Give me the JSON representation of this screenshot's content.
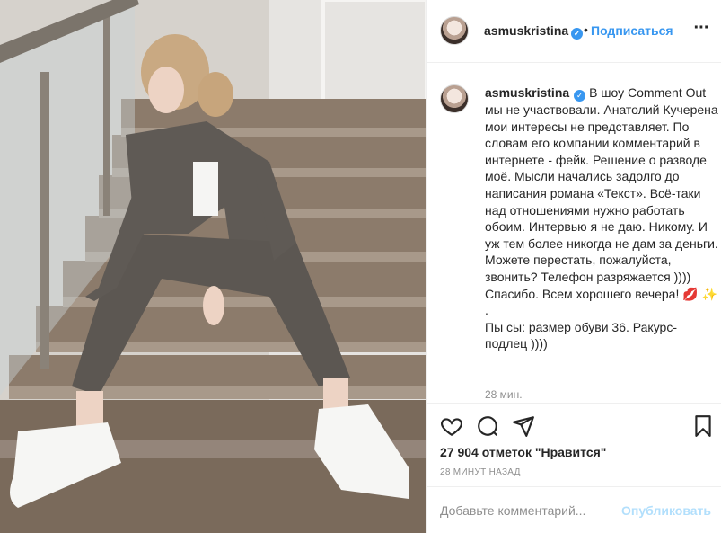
{
  "post": {
    "username": "asmuskristina",
    "verified_badge": "verified-icon",
    "follow_label": "Подписаться",
    "more_icon": "more-options-icon",
    "separator": "•"
  },
  "caption": {
    "username": "asmuskristina",
    "text": "В шоу Comment Out мы не участвовали. Анатолий Кучерена мои интересы не представляет. По словам его компании комментарий в интернете - фейк. Решение о разводе моё. Мысли начались задолго до написания романа «Текст». Всё-таки над отношениями нужно работать обоим. Интервью я не даю. Никому. И уж тем более никогда не дам за деньги. Можете перестать, пожалуйста, звонить? Телефон разряжается )))) Спасибо. Всем хорошего вечера! 💋 ✨\n.\nПы сы: размер обуви 36. Ракурс-подлец ))))",
    "time": "28 мин."
  },
  "actions": {
    "like_icon": "heart-icon",
    "comment_icon": "comment-icon",
    "share_icon": "share-icon",
    "save_icon": "bookmark-icon",
    "likes_text": "27 904 отметок \"Нравится\"",
    "post_time": "28 МИНУТ НАЗАД"
  },
  "comment": {
    "placeholder": "Добавьте комментарий...",
    "publish_label": "Опубликовать"
  },
  "colors": {
    "accent": "#3897f0",
    "publish_disabled": "#b2dffc",
    "text": "#262626",
    "muted": "#8e8e8e"
  }
}
